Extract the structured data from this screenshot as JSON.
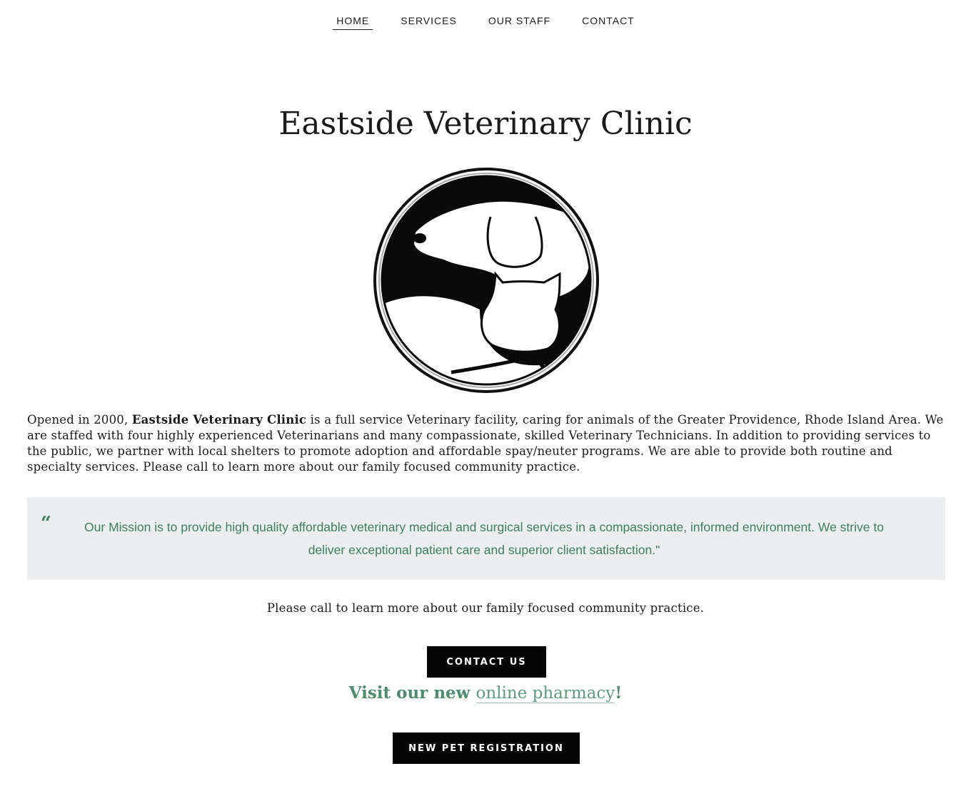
{
  "nav": {
    "items": [
      {
        "label": "HOME",
        "active": true
      },
      {
        "label": "SERVICES",
        "active": false
      },
      {
        "label": "OUR STAFF",
        "active": false
      },
      {
        "label": "CONTACT",
        "active": false
      }
    ]
  },
  "hero": {
    "title": "Eastside Veterinary Clinic",
    "logo_icon": "dog-and-cat-circle-logo"
  },
  "intro": {
    "prefix": "Opened in 2000, ",
    "clinic_name": "Eastside Veterinary Clinic",
    "body": " is a full service Veterinary facility, caring for animals of the Greater Providence, Rhode Island Area. We are staffed with four highly experienced Veterinarians and many compassionate, skilled Veterinary Technicians. In addition to providing services to the public, we partner with local shelters to promote adoption and affordable spay/neuter programs. We are able to provide both routine and specialty services. Please call to learn more about our family focused  community practice."
  },
  "mission": {
    "quote_mark": "“",
    "text": "Our Mission is to provide high quality affordable veterinary medical and surgical services in a compassionate, informed environment. We strive to deliver exceptional patient care and superior client satisfaction.\""
  },
  "call_text": "Please call to learn more about our family focused  community practice.",
  "buttons": {
    "contact": "CONTACT US",
    "register": "NEW PET REGISTRATION"
  },
  "pharmacy": {
    "prefix": "Visit our new ",
    "link": "online pharmacy",
    "suffix": "!"
  },
  "colors": {
    "accent_green": "#3c7f60",
    "quote_bg": "#ecedee",
    "button_bg": "#050505"
  }
}
